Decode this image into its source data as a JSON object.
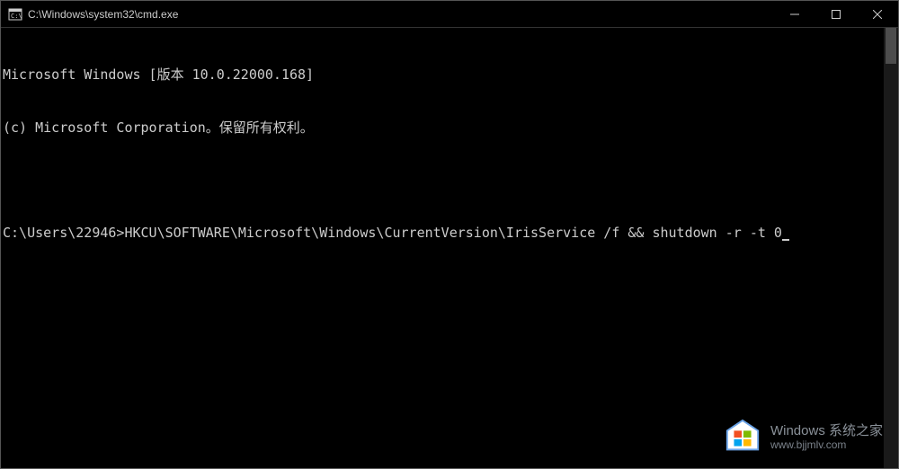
{
  "window": {
    "title": "C:\\Windows\\system32\\cmd.exe"
  },
  "terminal": {
    "line1": "Microsoft Windows [版本 10.0.22000.168]",
    "line2": "(c) Microsoft Corporation。保留所有权利。",
    "prompt": "C:\\Users\\22946>",
    "command": "HKCU\\SOFTWARE\\Microsoft\\Windows\\CurrentVersion\\IrisService /f && shutdown -r -t 0"
  },
  "watermark": {
    "title": "Windows 系统之家",
    "url": "www.bjjmlv.com"
  }
}
